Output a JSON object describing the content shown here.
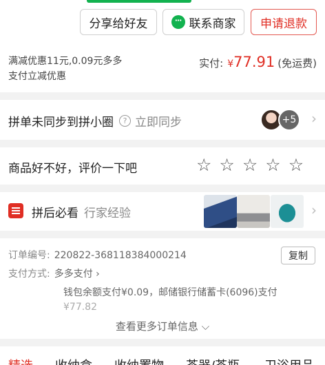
{
  "actions": {
    "share": "分享给好友",
    "contact": "联系商家",
    "refund": "申请退款"
  },
  "payment": {
    "discount_line1": "满减优惠11元,0.09元多多",
    "discount_line2": "支付立减优惠",
    "paid_label": "实付:",
    "currency": "¥",
    "amount": "77.91",
    "freeship": "(免运费)"
  },
  "sync": {
    "title": "拼单未同步到拼小圈",
    "question": "?",
    "link": "立即同步",
    "plus_count": "+5",
    "chevron": "›"
  },
  "rating": {
    "prompt": "商品好不好，评价一下吧",
    "stars": [
      "☆",
      "☆",
      "☆",
      "☆",
      "☆"
    ],
    "value": 0,
    "max": 5
  },
  "after_buy": {
    "title": "拼后必看",
    "subtitle": "行家经验",
    "chevron": "›"
  },
  "order": {
    "number_label": "订单编号:",
    "number": "220822-368118384000214",
    "copy": "复制",
    "method_label": "支付方式:",
    "method": "多多支付 ›",
    "detail": "钱包余额支付¥0.09，邮储银行储蓄卡(6096)支付",
    "total": "¥77.82",
    "more": "查看更多订单信息 ⌵"
  },
  "categories": [
    "精选",
    "收纳盒",
    "收纳置物",
    "茶器/茶瓶",
    "卫浴用品"
  ],
  "colors": {
    "accent_red": "#e02e24",
    "wechat_green": "#12b24f"
  }
}
